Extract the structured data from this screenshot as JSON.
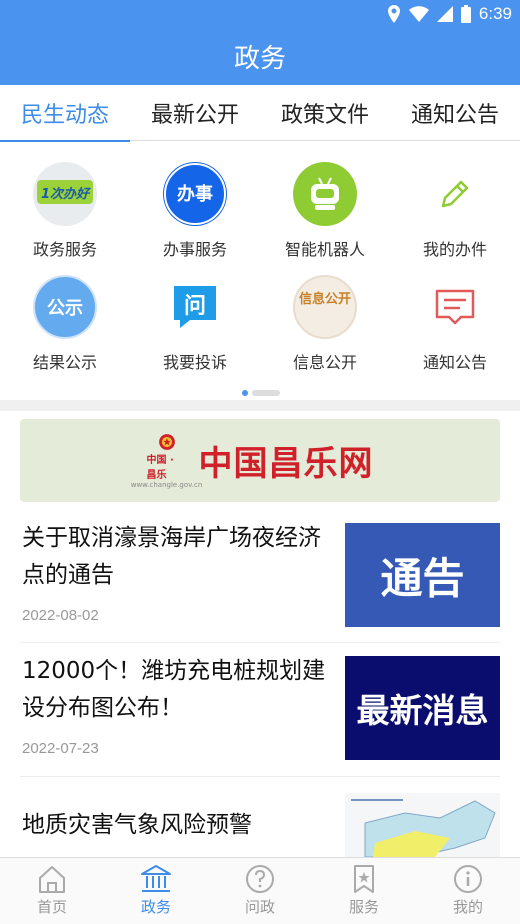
{
  "status": {
    "time": "6:39"
  },
  "header": {
    "title": "政务"
  },
  "tabs": [
    {
      "label": "民生动态",
      "active": true
    },
    {
      "label": "最新公开",
      "active": false
    },
    {
      "label": "政策文件",
      "active": false
    },
    {
      "label": "通知公告",
      "active": false
    }
  ],
  "grid": {
    "items": [
      {
        "label": "政务服务",
        "icon": "yi-ci-ban-hao-icon",
        "icon_text": "1次办好"
      },
      {
        "label": "办事服务",
        "icon": "ban-shi-icon",
        "icon_text": "办事"
      },
      {
        "label": "智能机器人",
        "icon": "robot-icon"
      },
      {
        "label": "我的办件",
        "icon": "pencil-icon"
      },
      {
        "label": "结果公示",
        "icon": "gong-shi-icon",
        "icon_text": "公示"
      },
      {
        "label": "我要投诉",
        "icon": "wen-complaint-icon",
        "icon_text": "问"
      },
      {
        "label": "信息公开",
        "icon": "xin-xi-gong-kai-icon",
        "icon_text": "信息公开"
      },
      {
        "label": "通知公告",
        "icon": "notice-icon"
      }
    ]
  },
  "banner": {
    "title": "中国昌乐网",
    "subtitle": "中国 · 昌乐",
    "url": "www.changle.gov.cn"
  },
  "news": [
    {
      "title": "关于取消濠景海岸广场夜经济点的通告",
      "date": "2022-08-02",
      "thumb_text": "通告"
    },
    {
      "title": "12000个！潍坊充电桩规划建设分布图公布！",
      "date": "2022-07-23",
      "thumb_text": "最新消息"
    },
    {
      "title": "地质灾害气象风险预警",
      "date": "",
      "thumb_text": ""
    }
  ],
  "bottom_nav": [
    {
      "label": "首页",
      "icon": "home-icon",
      "active": false
    },
    {
      "label": "政务",
      "icon": "government-building-icon",
      "active": true
    },
    {
      "label": "问政",
      "icon": "question-icon",
      "active": false
    },
    {
      "label": "服务",
      "icon": "bookmark-star-icon",
      "active": false
    },
    {
      "label": "我的",
      "icon": "info-icon",
      "active": false
    }
  ],
  "colors": {
    "primary": "#4a93ee",
    "accent": "#3d8ce8",
    "banner_red": "#d0202a"
  }
}
